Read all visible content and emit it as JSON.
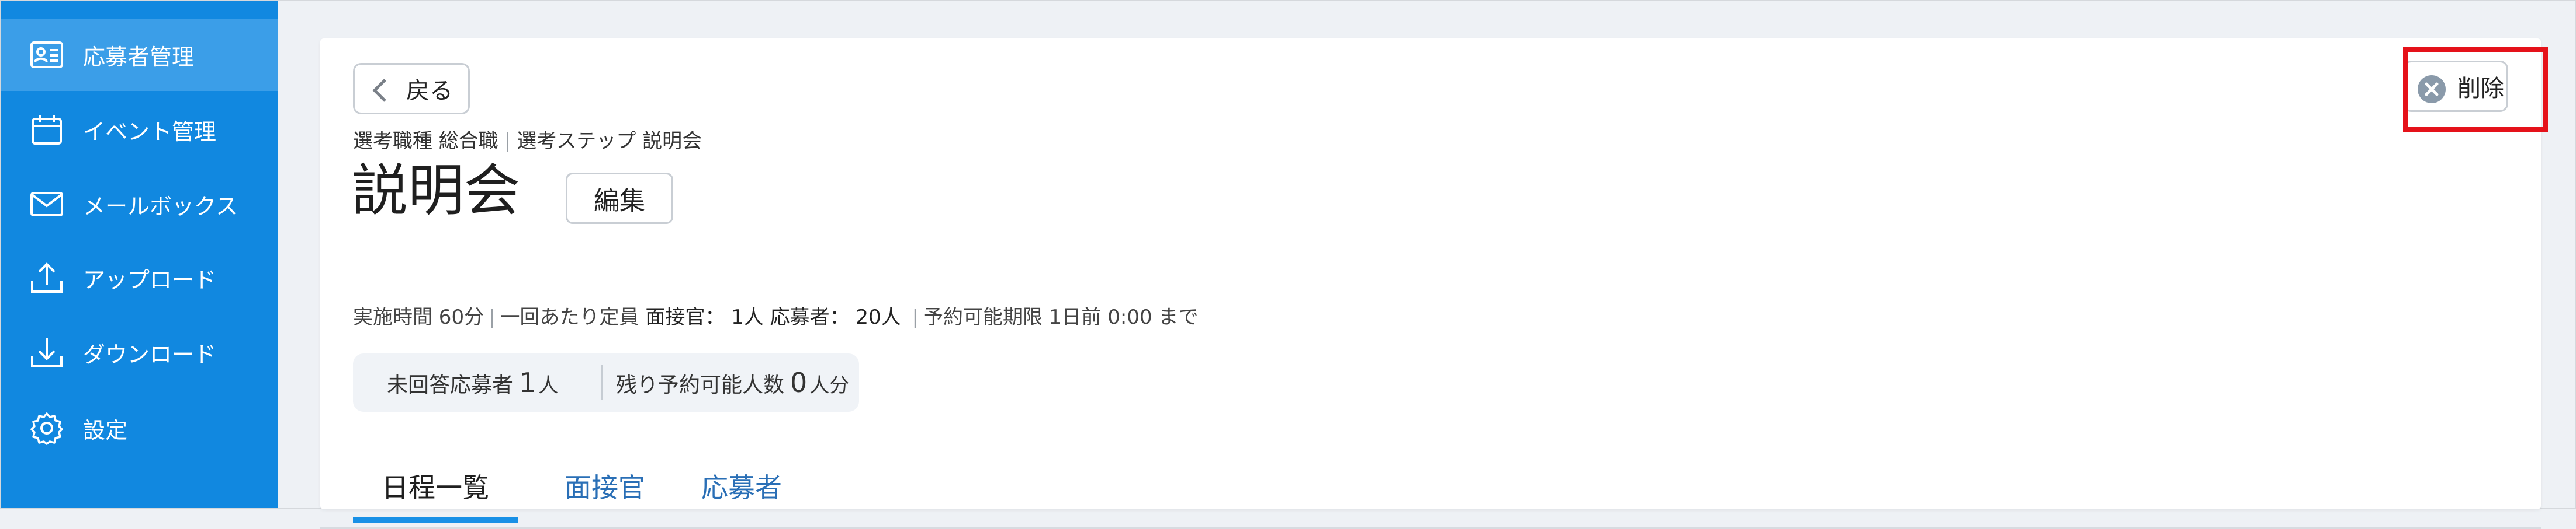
{
  "sidebar": {
    "items": [
      {
        "label": "応募者管理",
        "icon": "applicant-card-icon",
        "active": true
      },
      {
        "label": "イベント管理",
        "icon": "calendar-icon",
        "active": false
      },
      {
        "label": "メールボックス",
        "icon": "mail-icon",
        "active": false
      },
      {
        "label": "アップロード",
        "icon": "upload-icon",
        "active": false
      },
      {
        "label": "ダウンロード",
        "icon": "download-icon",
        "active": false
      },
      {
        "label": "設定",
        "icon": "gear-icon",
        "active": false
      }
    ]
  },
  "header": {
    "back_label": "戻る",
    "delete_label": "削除",
    "breadcrumb": {
      "job_type": "選考職種 総合職",
      "step": "選考ステップ 説明会"
    },
    "title": "説明会",
    "edit_label": "編集"
  },
  "meta": {
    "duration": "実施時間 60分",
    "capacity_label": "一回あたり定員",
    "interviewer": "面接官： 1人",
    "applicants": "応募者： 20人",
    "deadline": "予約可能期限 1日前 0:00 まで"
  },
  "stats": {
    "unanswered_label": "未回答応募者",
    "unanswered_value": "1",
    "unanswered_unit": "人",
    "remaining_label": "残り予約可能人数",
    "remaining_value": "0",
    "remaining_unit": "人分"
  },
  "tabs": [
    {
      "label": "日程一覧",
      "active": true
    },
    {
      "label": "面接官",
      "active": false
    },
    {
      "label": "応募者",
      "active": false
    }
  ],
  "colors": {
    "sidebar": "#1188e0",
    "sidebar_active": "#3b9ee8",
    "tab_active_underline": "#1890e6",
    "highlight": "#e5121a"
  }
}
